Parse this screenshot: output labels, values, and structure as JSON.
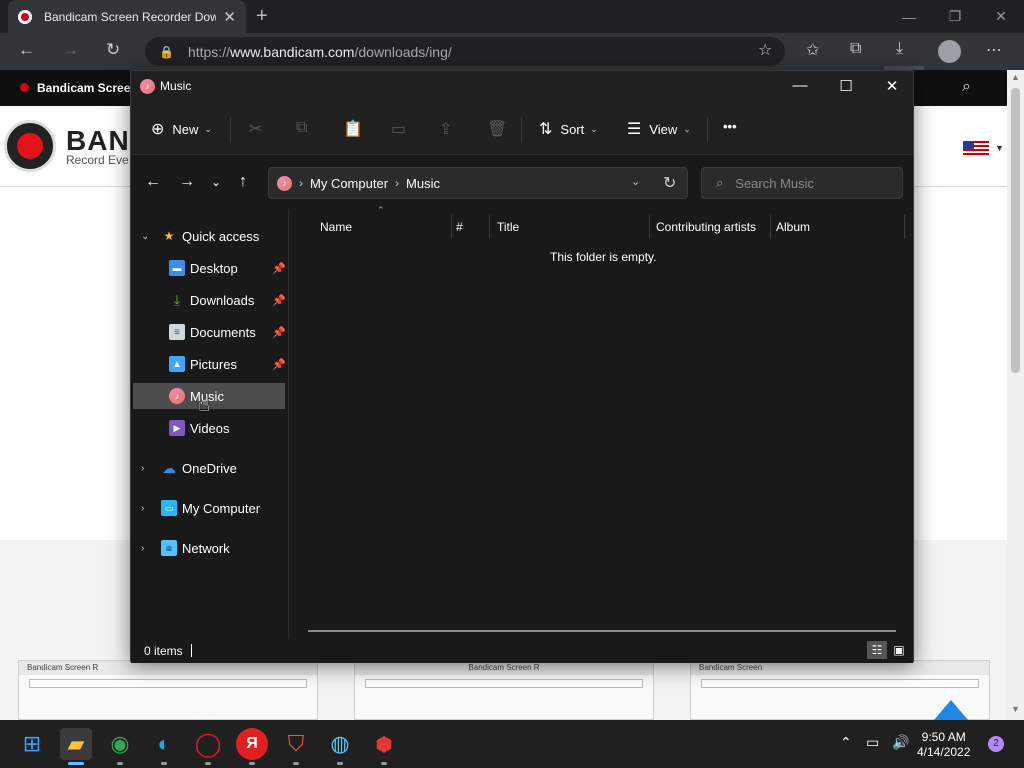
{
  "browser": {
    "tab_title": "Bandicam Screen Recorder Downloads",
    "url_prefix": "https://",
    "url_domain": "www.bandicam.com",
    "url_path": "/downloads/ing/"
  },
  "website": {
    "bar_brand": "Bandicam Screen",
    "name": "BAN",
    "tagline": "Record Eve",
    "thumb1": "Bandicam Screen R",
    "thumb2": "Bandicam Screen R",
    "thumb3": "Bandicam Screen"
  },
  "explorer": {
    "window_title": "Music",
    "commands": {
      "new": "New",
      "sort": "Sort",
      "view": "View",
      "more": "•••"
    },
    "breadcrumb": [
      "My Computer",
      "Music"
    ],
    "search_placeholder": "Search Music",
    "sidebar": {
      "quick_access": "Quick access",
      "items": [
        {
          "label": "Desktop",
          "pinned": true
        },
        {
          "label": "Downloads",
          "pinned": true
        },
        {
          "label": "Documents",
          "pinned": true
        },
        {
          "label": "Pictures",
          "pinned": true
        },
        {
          "label": "Music",
          "selected": true
        },
        {
          "label": "Videos"
        }
      ],
      "onedrive": "OneDrive",
      "my_computer": "My Computer",
      "network": "Network"
    },
    "columns": [
      "Name",
      "#",
      "Title",
      "Contributing artists",
      "Album"
    ],
    "empty_message": "This folder is empty.",
    "status": "0 items"
  },
  "taskbar": {
    "time": "9:50 AM",
    "date": "4/14/2022",
    "notifications": "2",
    "yandex_letter": "Я"
  },
  "colors": {
    "accent": "#0078d4",
    "selected": "#4d4d4d",
    "bandicam_red": "#d0021b"
  }
}
